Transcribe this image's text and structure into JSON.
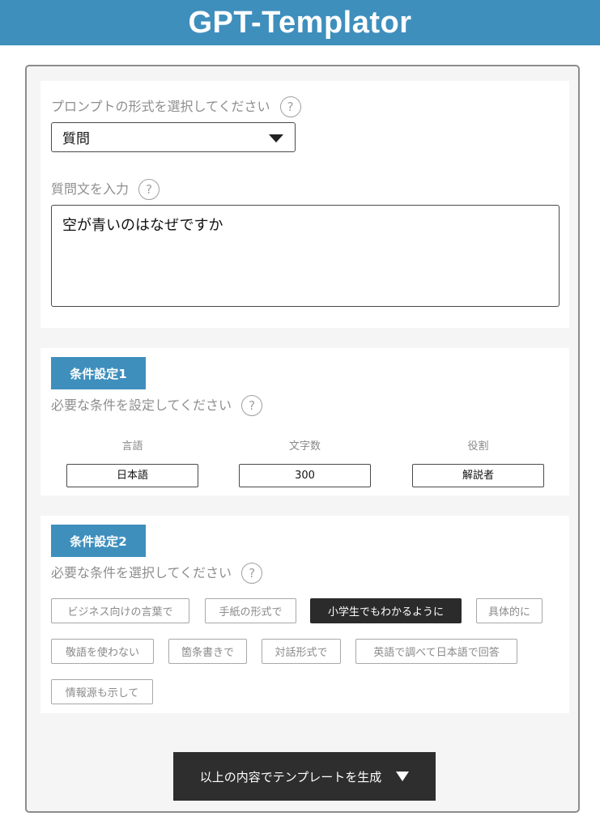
{
  "app": {
    "title": "GPT-Templator"
  },
  "help_mark": "?",
  "prompt_format": {
    "label": "プロンプトの形式を選択してください",
    "selected": "質問"
  },
  "question": {
    "label": "質問文を入力",
    "value": "空が青いのはなぜですか"
  },
  "conditions1": {
    "badge": "条件設定1",
    "instruction": "必要な条件を設定してください",
    "fields": [
      {
        "label": "言語",
        "value": "日本語"
      },
      {
        "label": "文字数",
        "value": "300"
      },
      {
        "label": "役割",
        "value": "解説者"
      }
    ]
  },
  "conditions2": {
    "badge": "条件設定2",
    "instruction": "必要な条件を選択してください",
    "tags": [
      {
        "label": "ビジネス向けの言葉で",
        "selected": false
      },
      {
        "label": "手紙の形式で",
        "selected": false
      },
      {
        "label": "小学生でもわかるように",
        "selected": true
      },
      {
        "label": "具体的に",
        "selected": false
      },
      {
        "label": "敬語を使わない",
        "selected": false
      },
      {
        "label": "箇条書きで",
        "selected": false
      },
      {
        "label": "対話形式で",
        "selected": false
      },
      {
        "label": "英語で調べて日本語で回答",
        "selected": false
      },
      {
        "label": "情報源も示して",
        "selected": false
      }
    ]
  },
  "generate": {
    "label": "以上の内容でテンプレートを生成"
  },
  "colors": {
    "accent": "#3f8fbd",
    "dark": "#2e2e2e",
    "muted_text": "#8e8e8e",
    "frame_bg": "#f5f5f5"
  },
  "icons": {
    "help": "help-circle-icon",
    "dropdown": "caret-down-icon",
    "generate": "triangle-down-icon"
  }
}
